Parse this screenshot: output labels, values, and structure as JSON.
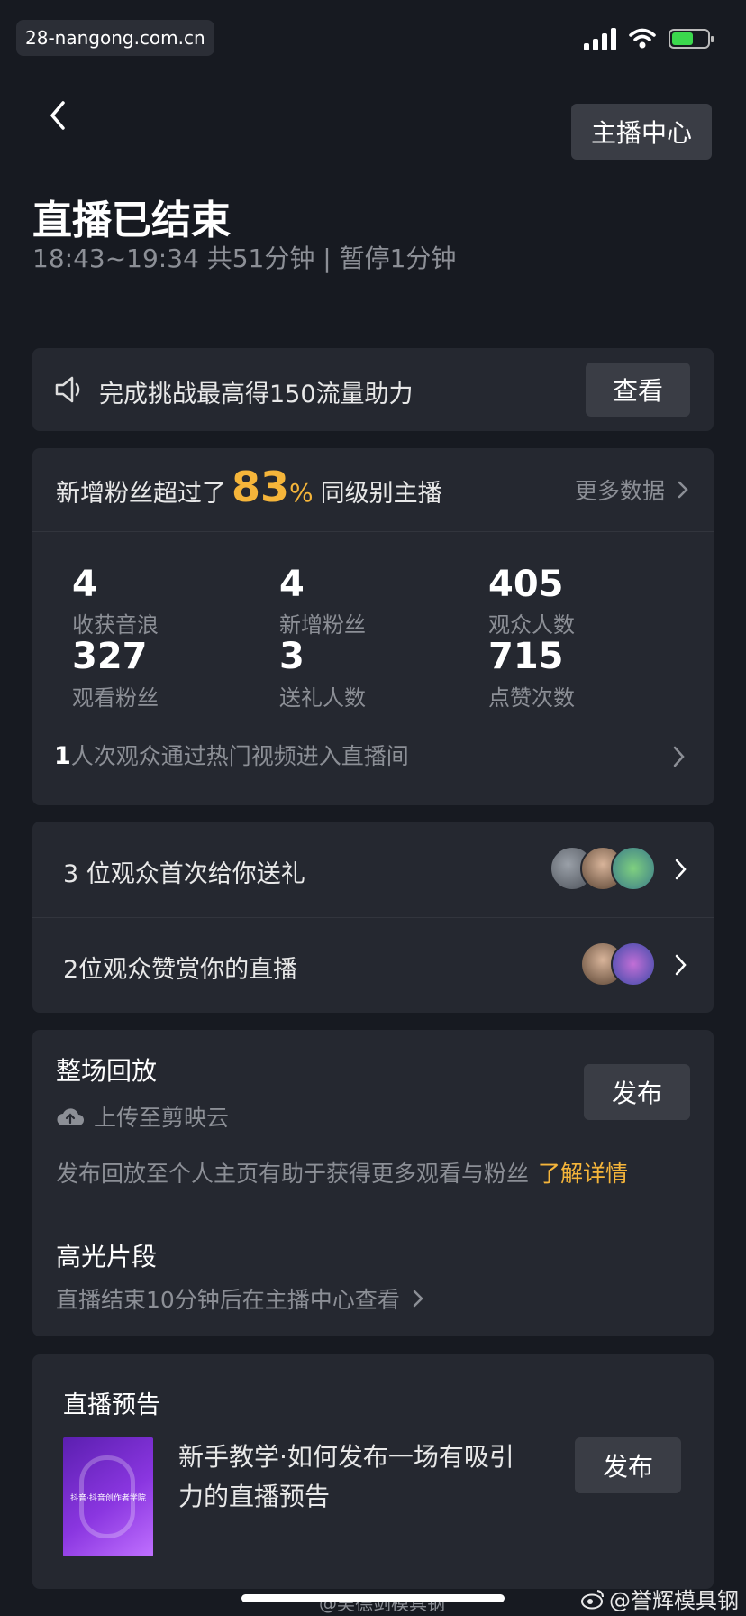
{
  "status_bar": {
    "watermark": "28-nangong.com.cn",
    "battery_level": 0.6
  },
  "header": {
    "host_center_label": "主播中心",
    "title": "直播已结束",
    "time_range": "18:43~19:34 共51分钟 | 暂停1分钟"
  },
  "challenge": {
    "text": "完成挑战最高得150流量助力",
    "button": "查看"
  },
  "stats": {
    "fans_prefix": "新增粉丝超过了",
    "fans_pct": "83",
    "pct_sign": "%",
    "fans_suffix": "同级别主播",
    "more_data": "更多数据",
    "items": [
      {
        "value": "4",
        "label": "收获音浪"
      },
      {
        "value": "4",
        "label": "新增粉丝"
      },
      {
        "value": "405",
        "label": "观众人数"
      },
      {
        "value": "327",
        "label": "观看粉丝"
      },
      {
        "value": "3",
        "label": "送礼人数"
      },
      {
        "value": "715",
        "label": "点赞次数"
      }
    ],
    "hot_count": "1",
    "hot_text": "人次观众通过热门视频进入直播间"
  },
  "viewers": {
    "gift_row": "3 位观众首次给你送礼",
    "like_row": "2位观众赞赏你的直播"
  },
  "replay": {
    "title": "整场回放",
    "upload": "上传至剪映云",
    "publish": "发布",
    "desc": "发布回放至个人主页有助于获得更多观看与粉丝",
    "learn_more": "了解详情",
    "highlight_title": "高光片段",
    "highlight_desc": "直播结束10分钟后在主播中心查看"
  },
  "preview": {
    "title": "直播预告",
    "desc_line1": "新手教学·如何发布一场有吸引",
    "desc_line2": "力的直播预告",
    "publish": "发布",
    "thumb_text": "抖音·抖音创作者学院"
  },
  "footer": {
    "watermark_left": "@吴德剑模具钢",
    "watermark_right": "@誉辉模具钢"
  },
  "colors": {
    "accent": "#f5b53a",
    "background": "#171a21",
    "card": "#252830",
    "button": "#3a3d45"
  }
}
